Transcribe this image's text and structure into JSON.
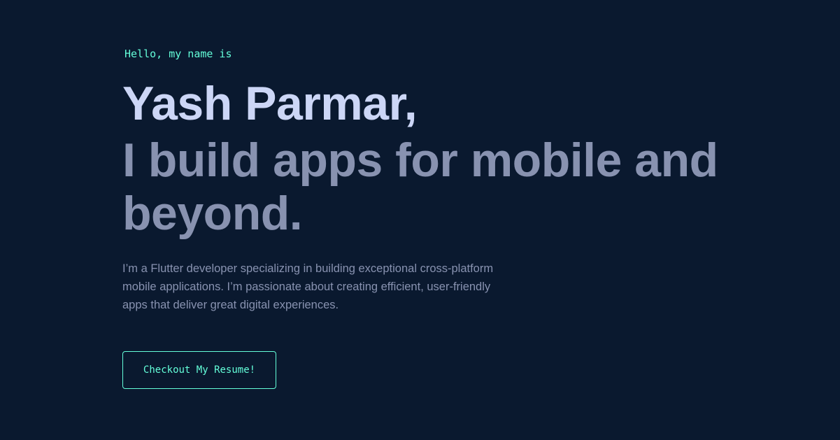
{
  "hero": {
    "greeting": "Hello, my name is",
    "name": "Yash Parmar,",
    "tagline": "I build apps for mobile and beyond.",
    "bio": "I’m a Flutter developer specializing in building exceptional cross-platform mobile applications. I’m passionate about creating efficient, user-friendly apps that deliver great digital experiences.",
    "cta_label": "Checkout My Resume!"
  },
  "colors": {
    "background": "#0a192f",
    "accent": "#64ffda",
    "heading": "#ccd6f6",
    "muted": "#8892b0"
  }
}
